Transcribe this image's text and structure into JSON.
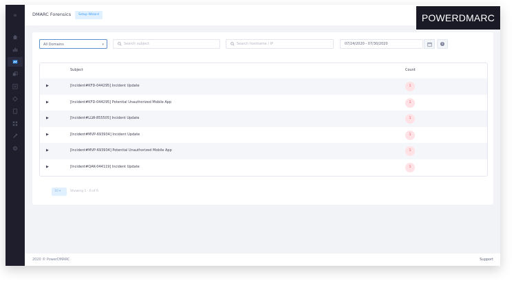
{
  "header": {
    "title": "DMARC Forensics",
    "setup_wizard_label": "Setup Wizard",
    "logo_text": "POWERDMARC"
  },
  "sidebar": {
    "items": [
      {
        "icon": "home-icon"
      },
      {
        "icon": "analytics-icon"
      },
      {
        "icon": "reports-icon",
        "active": true
      },
      {
        "icon": "domain-icon"
      },
      {
        "icon": "integration-icon"
      },
      {
        "icon": "hosted-services-icon"
      },
      {
        "icon": "document-icon"
      },
      {
        "icon": "grid-icon"
      },
      {
        "icon": "tools-icon"
      },
      {
        "icon": "settings-icon"
      }
    ]
  },
  "filters": {
    "domain_select_value": "All Domains",
    "search_subject_placeholder": "Search subject",
    "search_hostname_placeholder": "Search hostname / IP",
    "date_range": "07/24/2020 - 07/30/2020"
  },
  "table": {
    "columns": {
      "subject": "Subject",
      "count": "Count"
    },
    "rows": [
      {
        "subject": "[Incident#KFD-044295] Incident Update",
        "count": "1"
      },
      {
        "subject": "[Incident#KFD-044295] Potential Unauthorized Mobile App",
        "count": "1"
      },
      {
        "subject": "[Incident#LLW-855505] Incident Update",
        "count": "1"
      },
      {
        "subject": "[Incident#MVP-693934] Incident Update",
        "count": "1"
      },
      {
        "subject": "[Incident#MVP-693934] Potential Unauthorized Mobile App",
        "count": "1"
      },
      {
        "subject": "[Incident#QAK-044119] Incident Update",
        "count": "1"
      }
    ]
  },
  "pager": {
    "page_size": "10",
    "showing": "Showing 1 - 6 of 6"
  },
  "footer": {
    "copyright": "2020 © PowerDMARC",
    "support": "Support"
  },
  "colors": {
    "sidebar_bg": "#1e1e2d",
    "accent": "#3699ff",
    "count_badge_bg": "#ffe2e5",
    "count_badge_text": "#f64e60"
  }
}
